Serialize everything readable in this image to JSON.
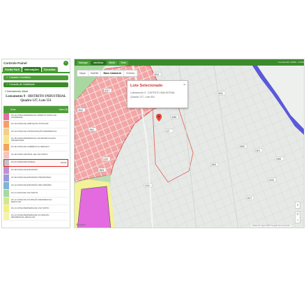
{
  "panel": {
    "title": "Controle Painel",
    "toggle_icon": "chevron-left-icon",
    "tabs": [
      {
        "label": "Gestão Fácil"
      },
      {
        "label": "Informações"
      },
      {
        "label": "Consultas"
      }
    ],
    "accordions": [
      {
        "label": "Cadastro Imobiliário"
      },
      {
        "label": "Consulta de Viabilidade"
      }
    ],
    "sub_header": "Zoneamento Atual",
    "lot_title_line1": "Loteamento 9 - DISTRITO INDUSTRIAL",
    "lot_title_line2": "Quadra 127, Lote 551",
    "table": {
      "col_zone": "Zona",
      "col_area": "Área (%)",
      "rows": [
        {
          "text": "ZC-02 ZONA RESIDENCIAL PREDITO POPULAR - INTERESSE",
          "area": "",
          "color": "#e46fa3"
        },
        {
          "text": "ZC-03 ZONA DE HABITAÇÃO POPULAR",
          "area": "",
          "color": "#f2a06a"
        },
        {
          "text": "ZC-04 ZONA DE CONSOLIDAÇÃO RESIDENCIAL",
          "area": "",
          "color": "#f4cf87"
        },
        {
          "text": "ZC-05 ZONA RESIDENCIAL DE DENSIFICAÇÃO PRIORITÁRIA",
          "area": "",
          "color": "#f7e38a"
        },
        {
          "text": "ZC-06 ZONA DE COMÉRCIO E SERVIÇO",
          "area": "",
          "color": "#f0a55a"
        },
        {
          "text": "ZC-06 ZONA CENTRAL DE USO MISTO",
          "area": "",
          "color": "#f9c1c0"
        },
        {
          "text": "ZC-07 ZONA INDUSTRIAL",
          "area": "100.00",
          "color": "#c4c4c8",
          "selected": true
        },
        {
          "text": "ZC-08 ZONA DE EXPANSÃO",
          "area": "",
          "color": "#c28fd4"
        },
        {
          "text": "ZC-09 ZONA DE EXPANSÃO PRIORITÁRIA",
          "area": "",
          "color": "#9a9ad6"
        },
        {
          "text": "ZC-10 ZONA DE EXPANSÃO SECUNDÁRIA",
          "area": "",
          "color": "#7fb3d9"
        },
        {
          "text": "ZC-11 ZONA DE USO MISTO",
          "area": "",
          "color": "#a8d8a0"
        },
        {
          "text": "ZC-12 ZONA DE OCUPAÇÃO RESIDENCIAL REGULAR",
          "area": "",
          "color": "#d3e88c"
        },
        {
          "text": "ZC-13 ZONA PERIFERIA DE USO MISTO",
          "area": "",
          "color": "#f3f17c"
        },
        {
          "text": "ZC-14 ZONA PERIFERIA DE OCUPAÇÃO RESIDENCIAL REGULAR",
          "area": "",
          "color": "#f7f3a6"
        }
      ]
    }
  },
  "map": {
    "toolbar": [
      {
        "label": "Navegar"
      },
      {
        "label": "Identificar"
      },
      {
        "label": "Medir"
      },
      {
        "label": "Texto"
      }
    ],
    "coordinate_readout": "Coordenada: 26996 - 21600",
    "map_types": [
      {
        "label": "Mapa"
      },
      {
        "label": "Satélite"
      },
      {
        "label": "Base Cadastral"
      },
      {
        "label": "Ortofoto"
      }
    ],
    "popup": {
      "title": "Lote Selecionado",
      "line1": "Loteamento 9 - DISTRITO INDUSTRIAL",
      "line2": "Quadra 127, Lote 551",
      "close_icon": "close-icon"
    },
    "labels": {
      "l1": "4513",
      "l2": "4017",
      "l3": "3512",
      "l4": "4061",
      "l5": "127",
      "l6": "1010",
      "l7": "4506",
      "l8": "4038",
      "l9": "3911",
      "l10": "3920",
      "l11": "1999",
      "l12": "1001",
      "l13": "2903",
      "l14": "2410",
      "l15": "2107",
      "l16": "1011"
    },
    "google_logo": "Google",
    "attribution": "Dados do mapa ©2017 Google  Termos de Uso",
    "zoom_in": "+",
    "zoom_out": "−",
    "colors": {
      "residential": "#f2a6a6",
      "residential_border": "#d13b3b",
      "industrial": "#e6e9e6",
      "water": "#5a5ad8",
      "expansion": "#e46ae0",
      "yellow_zone": "#f5f19a",
      "toolbar": "#3c8b2b"
    }
  }
}
